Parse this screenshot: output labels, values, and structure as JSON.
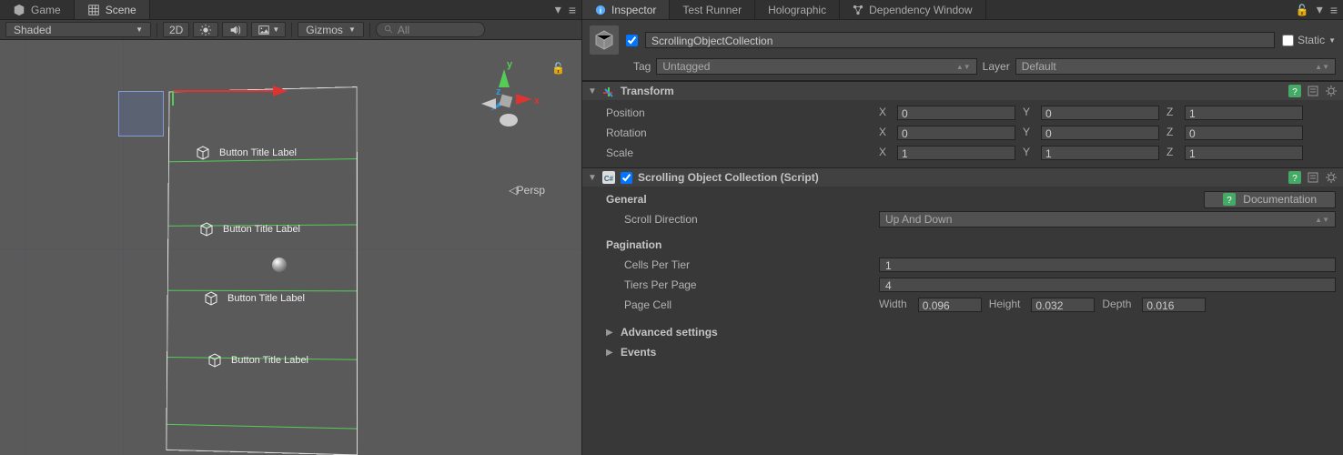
{
  "sceneTabs": {
    "game": "Game",
    "scene": "Scene"
  },
  "sceneToolbar": {
    "shading": "Shaded",
    "btn2d": "2D",
    "gizmos": "Gizmos",
    "searchPlaceholder": "All"
  },
  "sceneView": {
    "buttonLabels": [
      "Button Title Label",
      "Button Title Label",
      "Button Title Label",
      "Button Title Label"
    ],
    "persp": "Persp"
  },
  "inspectorTabs": {
    "inspector": "Inspector",
    "testRunner": "Test Runner",
    "holographic": "Holographic",
    "dependency": "Dependency Window"
  },
  "gameObject": {
    "name": "ScrollingObjectCollection",
    "staticLabel": "Static",
    "tagLabel": "Tag",
    "tagValue": "Untagged",
    "layerLabel": "Layer",
    "layerValue": "Default"
  },
  "transform": {
    "title": "Transform",
    "position": {
      "label": "Position",
      "x": "0",
      "y": "0",
      "z": "1"
    },
    "rotation": {
      "label": "Rotation",
      "x": "0",
      "y": "0",
      "z": "0"
    },
    "scale": {
      "label": "Scale",
      "x": "1",
      "y": "1",
      "z": "1"
    }
  },
  "script": {
    "title": "Scrolling Object Collection (Script)",
    "docBtn": "Documentation",
    "general": "General",
    "scrollDirection": {
      "label": "Scroll Direction",
      "value": "Up And Down"
    },
    "pagination": "Pagination",
    "cellsPerTier": {
      "label": "Cells Per Tier",
      "value": "1"
    },
    "tiersPerPage": {
      "label": "Tiers Per Page",
      "value": "4"
    },
    "pageCell": {
      "label": "Page Cell",
      "widthLabel": "Width",
      "width": "0.096",
      "heightLabel": "Height",
      "height": "0.032",
      "depthLabel": "Depth",
      "depth": "0.016"
    },
    "advanced": "Advanced settings",
    "events": "Events"
  }
}
